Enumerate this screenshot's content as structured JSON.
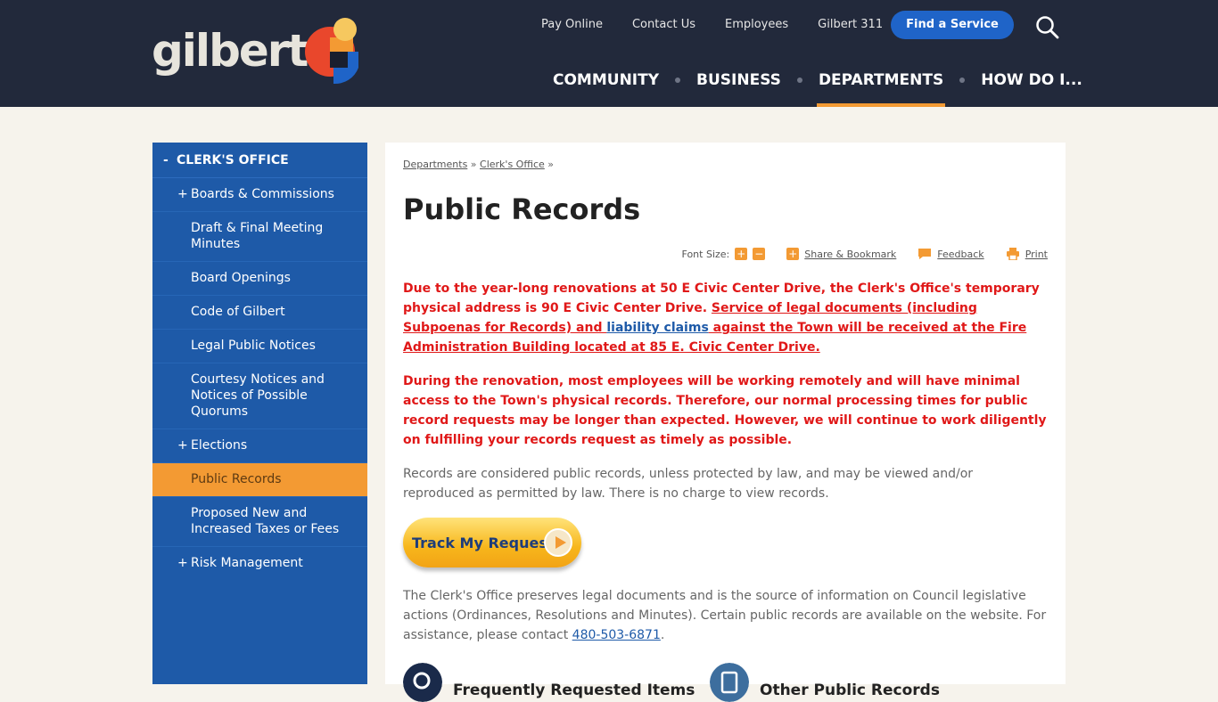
{
  "header": {
    "logo": "gilbert",
    "utility": [
      "Pay Online",
      "Contact Us",
      "Employees",
      "Gilbert 311"
    ],
    "find_service": "Find a Service",
    "nav": [
      "COMMUNITY",
      "BUSINESS",
      "DEPARTMENTS",
      "HOW DO I..."
    ],
    "active_nav": "DEPARTMENTS"
  },
  "sidebar": {
    "heading": "CLERK'S OFFICE",
    "heading_sign": "-",
    "items": [
      {
        "label": "Boards & Commissions",
        "sign": "+"
      },
      {
        "label": "Draft & Final Meeting Minutes",
        "sign": ""
      },
      {
        "label": "Board Openings",
        "sign": ""
      },
      {
        "label": "Code of Gilbert",
        "sign": ""
      },
      {
        "label": "Legal Public Notices",
        "sign": ""
      },
      {
        "label": "Courtesy Notices and Notices of Possible Quorums",
        "sign": ""
      },
      {
        "label": "Elections",
        "sign": "+"
      },
      {
        "label": "Public Records",
        "sign": ""
      },
      {
        "label": "Proposed New and Increased Taxes or Fees",
        "sign": ""
      },
      {
        "label": "Risk Management",
        "sign": "+"
      }
    ]
  },
  "content": {
    "breadcrumb": [
      "Departments",
      "Clerk's Office"
    ],
    "breadcrumb_sep": "»",
    "title": "Public Records",
    "toolbar": {
      "font_size": "Font Size:",
      "plus": "+",
      "minus": "−",
      "share": "Share & Bookmark",
      "feedback": "Feedback",
      "print": "Print"
    },
    "alert1": {
      "text_a": "Due to the year-long renovations at 50 E Civic Center Drive, the Clerk's Office's temporary physical address is 90 E Civic Center Drive. ",
      "link_a": "Service of legal documents (including Subpoenas for Records) and ",
      "link_b": "liability claims",
      "link_c": " against the Town will be received at the Fire Administration Building located at 85 E. Civic Center Drive."
    },
    "alert2": "During the renovation, most employees will be working remotely and will have minimal access to the Town's physical records.  Therefore, our normal processing times for public record requests may be longer than expected. However, we will continue to work diligently on fulfilling your records request as timely as possible.",
    "para1": "Records are considered public records, unless protected by law, and may be viewed and/or reproduced as permitted by law. There is no charge to view records.",
    "track_button": "Track My Request",
    "para2_text": "The Clerk's Office preserves legal documents and is the source of information on Council legislative actions (Ordinances, Resolutions and Minutes). Certain public records are available on the website. For assistance, please contact ",
    "para2_phone": "480-503-6871",
    "para2_end": ".",
    "quick_links": [
      "Frequently Requested Items",
      "Other Public Records"
    ]
  },
  "colors": {
    "header_bg": "#22293b",
    "sidebar_bg": "#1e5aa8",
    "accent_orange": "#f39a33",
    "alert_red": "#e01818",
    "link_blue": "#1e5aa8"
  }
}
